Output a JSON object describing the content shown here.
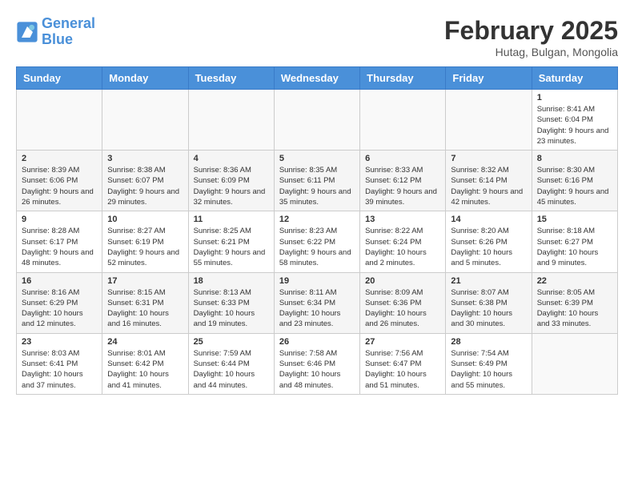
{
  "header": {
    "logo_line1": "General",
    "logo_line2": "Blue",
    "title": "February 2025",
    "subtitle": "Hutag, Bulgan, Mongolia"
  },
  "weekdays": [
    "Sunday",
    "Monday",
    "Tuesday",
    "Wednesday",
    "Thursday",
    "Friday",
    "Saturday"
  ],
  "weeks": [
    [
      {
        "day": "",
        "info": ""
      },
      {
        "day": "",
        "info": ""
      },
      {
        "day": "",
        "info": ""
      },
      {
        "day": "",
        "info": ""
      },
      {
        "day": "",
        "info": ""
      },
      {
        "day": "",
        "info": ""
      },
      {
        "day": "1",
        "info": "Sunrise: 8:41 AM\nSunset: 6:04 PM\nDaylight: 9 hours and 23 minutes."
      }
    ],
    [
      {
        "day": "2",
        "info": "Sunrise: 8:39 AM\nSunset: 6:06 PM\nDaylight: 9 hours and 26 minutes."
      },
      {
        "day": "3",
        "info": "Sunrise: 8:38 AM\nSunset: 6:07 PM\nDaylight: 9 hours and 29 minutes."
      },
      {
        "day": "4",
        "info": "Sunrise: 8:36 AM\nSunset: 6:09 PM\nDaylight: 9 hours and 32 minutes."
      },
      {
        "day": "5",
        "info": "Sunrise: 8:35 AM\nSunset: 6:11 PM\nDaylight: 9 hours and 35 minutes."
      },
      {
        "day": "6",
        "info": "Sunrise: 8:33 AM\nSunset: 6:12 PM\nDaylight: 9 hours and 39 minutes."
      },
      {
        "day": "7",
        "info": "Sunrise: 8:32 AM\nSunset: 6:14 PM\nDaylight: 9 hours and 42 minutes."
      },
      {
        "day": "8",
        "info": "Sunrise: 8:30 AM\nSunset: 6:16 PM\nDaylight: 9 hours and 45 minutes."
      }
    ],
    [
      {
        "day": "9",
        "info": "Sunrise: 8:28 AM\nSunset: 6:17 PM\nDaylight: 9 hours and 48 minutes."
      },
      {
        "day": "10",
        "info": "Sunrise: 8:27 AM\nSunset: 6:19 PM\nDaylight: 9 hours and 52 minutes."
      },
      {
        "day": "11",
        "info": "Sunrise: 8:25 AM\nSunset: 6:21 PM\nDaylight: 9 hours and 55 minutes."
      },
      {
        "day": "12",
        "info": "Sunrise: 8:23 AM\nSunset: 6:22 PM\nDaylight: 9 hours and 58 minutes."
      },
      {
        "day": "13",
        "info": "Sunrise: 8:22 AM\nSunset: 6:24 PM\nDaylight: 10 hours and 2 minutes."
      },
      {
        "day": "14",
        "info": "Sunrise: 8:20 AM\nSunset: 6:26 PM\nDaylight: 10 hours and 5 minutes."
      },
      {
        "day": "15",
        "info": "Sunrise: 8:18 AM\nSunset: 6:27 PM\nDaylight: 10 hours and 9 minutes."
      }
    ],
    [
      {
        "day": "16",
        "info": "Sunrise: 8:16 AM\nSunset: 6:29 PM\nDaylight: 10 hours and 12 minutes."
      },
      {
        "day": "17",
        "info": "Sunrise: 8:15 AM\nSunset: 6:31 PM\nDaylight: 10 hours and 16 minutes."
      },
      {
        "day": "18",
        "info": "Sunrise: 8:13 AM\nSunset: 6:33 PM\nDaylight: 10 hours and 19 minutes."
      },
      {
        "day": "19",
        "info": "Sunrise: 8:11 AM\nSunset: 6:34 PM\nDaylight: 10 hours and 23 minutes."
      },
      {
        "day": "20",
        "info": "Sunrise: 8:09 AM\nSunset: 6:36 PM\nDaylight: 10 hours and 26 minutes."
      },
      {
        "day": "21",
        "info": "Sunrise: 8:07 AM\nSunset: 6:38 PM\nDaylight: 10 hours and 30 minutes."
      },
      {
        "day": "22",
        "info": "Sunrise: 8:05 AM\nSunset: 6:39 PM\nDaylight: 10 hours and 33 minutes."
      }
    ],
    [
      {
        "day": "23",
        "info": "Sunrise: 8:03 AM\nSunset: 6:41 PM\nDaylight: 10 hours and 37 minutes."
      },
      {
        "day": "24",
        "info": "Sunrise: 8:01 AM\nSunset: 6:42 PM\nDaylight: 10 hours and 41 minutes."
      },
      {
        "day": "25",
        "info": "Sunrise: 7:59 AM\nSunset: 6:44 PM\nDaylight: 10 hours and 44 minutes."
      },
      {
        "day": "26",
        "info": "Sunrise: 7:58 AM\nSunset: 6:46 PM\nDaylight: 10 hours and 48 minutes."
      },
      {
        "day": "27",
        "info": "Sunrise: 7:56 AM\nSunset: 6:47 PM\nDaylight: 10 hours and 51 minutes."
      },
      {
        "day": "28",
        "info": "Sunrise: 7:54 AM\nSunset: 6:49 PM\nDaylight: 10 hours and 55 minutes."
      },
      {
        "day": "",
        "info": ""
      }
    ]
  ]
}
